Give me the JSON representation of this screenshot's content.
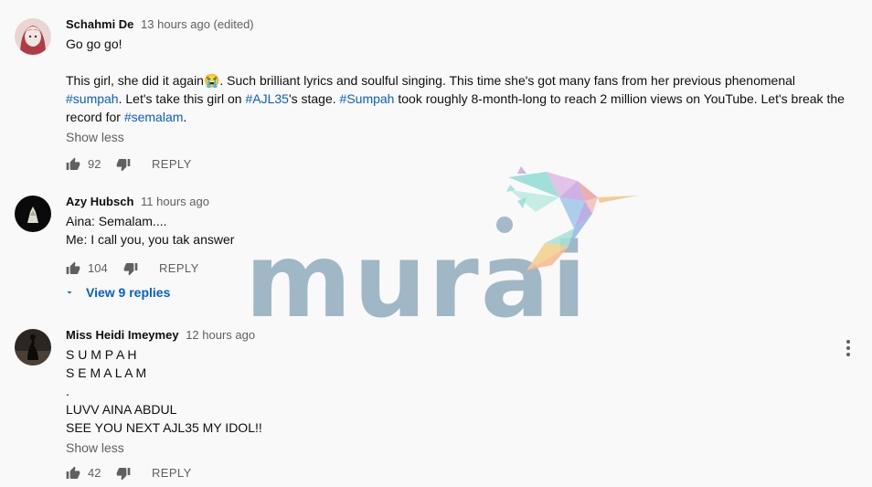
{
  "comments": [
    {
      "author": "Schahmi De",
      "time": "13 hours ago (edited)",
      "lines": [
        {
          "segments": [
            {
              "text": "Go go go!"
            }
          ]
        },
        {
          "segments": []
        },
        {
          "segments": [
            {
              "text": "This girl, she did it again😭. Such brilliant lyrics and soulful singing. This time she's got many fans from her previous phenomenal"
            }
          ]
        },
        {
          "segments": [
            {
              "text": "#sumpah",
              "hashtag": true
            },
            {
              "text": ". Let's take this girl on "
            },
            {
              "text": "#AJL35",
              "hashtag": true
            },
            {
              "text": "'s stage. "
            },
            {
              "text": "#Sumpah",
              "hashtag": true
            },
            {
              "text": " took roughly 8-month-long to reach 2 million views on YouTube. Let's break the"
            }
          ]
        },
        {
          "segments": [
            {
              "text": "record for "
            },
            {
              "text": "#semalam",
              "hashtag": true
            },
            {
              "text": "."
            }
          ]
        }
      ],
      "show_less": "Show less",
      "likes": "92",
      "reply": "REPLY"
    },
    {
      "author": "Azy Hubsch",
      "time": "11 hours ago",
      "lines": [
        {
          "segments": [
            {
              "text": "Aina: Semalam...."
            }
          ]
        },
        {
          "segments": [
            {
              "text": "Me: I call you, you tak answer"
            }
          ]
        }
      ],
      "likes": "104",
      "reply": "REPLY",
      "view_replies": "View 9 replies"
    },
    {
      "author": "Miss Heidi Imeymey",
      "time": "12 hours ago",
      "lines": [
        {
          "segments": [
            {
              "text": "S U M P A H"
            }
          ]
        },
        {
          "segments": [
            {
              "text": "S E M A L A M"
            }
          ]
        },
        {
          "segments": [
            {
              "text": "."
            }
          ]
        },
        {
          "segments": [
            {
              "text": "LUVV AINA ABDUL"
            }
          ]
        },
        {
          "segments": [
            {
              "text": "SEE YOU NEXT AJL35 MY IDOL!!"
            }
          ]
        }
      ],
      "show_less": "Show less",
      "likes": "42",
      "reply": "REPLY"
    }
  ],
  "watermark": {
    "text": "murai"
  },
  "colors": {
    "hashtag": "#065fd4",
    "secondary": "#606060",
    "watermark": "#94b0bf"
  },
  "icons": [
    "thumbs-up-icon",
    "thumbs-down-icon",
    "chevron-down-icon",
    "more-vert-icon"
  ]
}
